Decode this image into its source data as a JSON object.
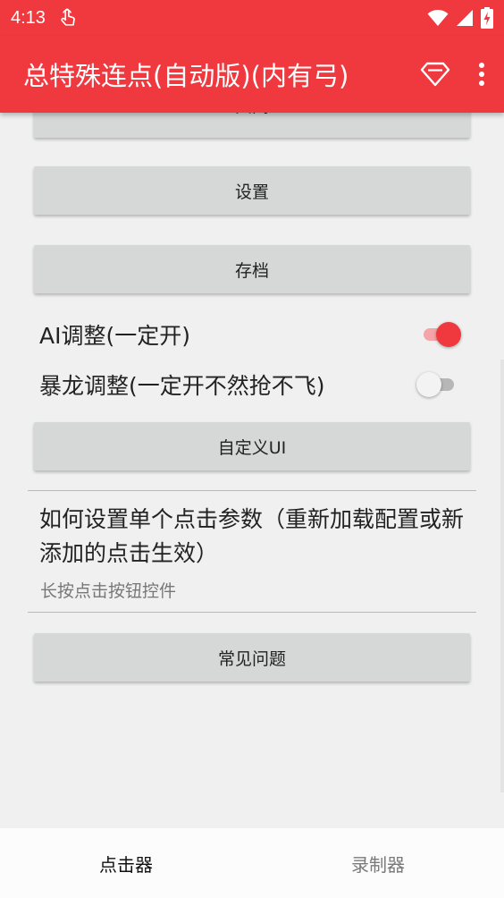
{
  "status_bar": {
    "time": "4:13"
  },
  "app_bar": {
    "title": "总特殊连点(自动版)(内有弓)",
    "actions": [
      "diamond-icon",
      "more-vert-icon"
    ]
  },
  "colors": {
    "accent": "#f0393f",
    "button_bg": "#d6d7d7",
    "background": "#f0f0f0"
  },
  "buttons": {
    "close_label": "关闭",
    "settings_label": "设置",
    "save_label": "存档",
    "custom_ui_label": "自定义UI",
    "faq_label": "常见问题"
  },
  "switches": [
    {
      "label": "AI调整(一定开)",
      "checked": true
    },
    {
      "label": "暴龙调整(一定开不然抢不飞)",
      "checked": false
    }
  ],
  "preference": {
    "title": "如何设置单个点击参数（重新加载配置或新添加的点击生效）",
    "summary": "长按点击按钮控件"
  },
  "bottom_nav": {
    "items": [
      {
        "label": "点击器",
        "active": true
      },
      {
        "label": "录制器",
        "active": false
      }
    ]
  }
}
